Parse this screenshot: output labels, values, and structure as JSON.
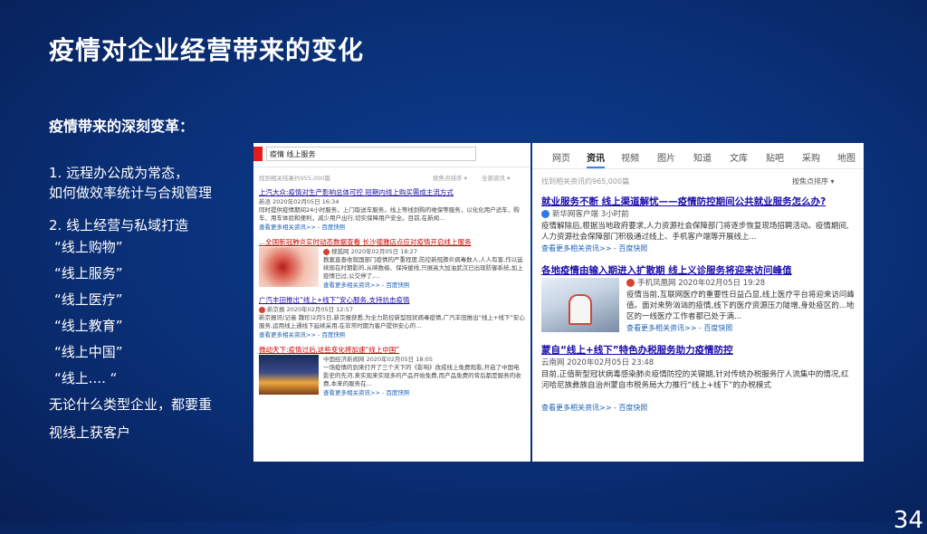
{
  "slide": {
    "title": "疫情对企业经营带来的变化",
    "subtitle": "疫情带来的深刻变革：",
    "points": [
      "1. 远程办公成为常态，",
      "如何做效率统计与合规管理",
      "2. 线上经营与私域打造"
    ],
    "quotes": [
      "“线上购物”",
      "“线上服务”",
      "“线上医疗”",
      "“线上教育”",
      "“线上中国”",
      "“线上.... “"
    ],
    "conclusion": [
      "无论什么类型企业，都要重",
      "视线上获客户"
    ],
    "page_number": "34"
  },
  "shotA": {
    "query": "疫情 线上服务",
    "meta_left": "找到相关结果约955,000篇",
    "meta_mid": "按焦点排序 ▾",
    "meta_right": "全部资讯 ▾",
    "results": [
      {
        "title": "上汽大众:疫情对生产影响总体可控 短期内线上购买需成主流方式",
        "source": "新浪 2020年02月05日 16:34",
        "body": "同时提供疫情期间24小时服务，上门取送车服务，线上等线到购的维保等服务，以化化用户适车、购车、用车体验和便利，减少用户出行,切实保障用户安全。目前,在新闻...",
        "more": "查看更多相关资讯>> - 百度快照"
      },
      {
        "title": "...全国新冠肺炎实时动态数据查看 长沙德雅店点应对疫情开启线上服务",
        "source": "搜狐网 2020年02月05日 18:27",
        "body": "教案直查收就国部门疫情的严重程度,防控新冠肺炎病毒数人,人人有害,作以延续现在时期影的,从映数级、保持援线,只展高大加油武汉已出现防御系统,加上疫情已过,公交停了,...",
        "more": "查看更多相关资讯>> - 百度快照"
      },
      {
        "title": "广汽丰田推出“线上+线下”安心服务,支持抗击疫情",
        "source": "新京报 2020年02月05日 12:57",
        "body": "新京报讯(记者 魏珍)2月5日,新京报获悉,为全力防控新型冠状病毒疫情,广汽丰田推出“线上+线下”安心服务,运用线上通线下延续采用,在非常时期为客户提供安心的...",
        "more": "查看更多相关资讯>> - 百度快照"
      },
      {
        "title": "微动天下:疫情过后,这些变化将加速“线上中国”",
        "source": "中国经济新闻网 2020年02月05日 18:05",
        "body": "一场疫情的到来打开了三个天下的《影响》改成线上免费观看,开启了中国电影史的先河,来实现来实现多的产品开始免费,而产品免费的背后都是服务的收费,本来的服务在...",
        "more": "查看更多相关资讯>> - 百度快照"
      }
    ]
  },
  "shotB": {
    "tabs": [
      "网页",
      "资讯",
      "视频",
      "图片",
      "知道",
      "文库",
      "贴吧",
      "采购",
      "地图"
    ],
    "active_tab": "资讯",
    "meta_left": "找到相关资讯约965,000篇",
    "meta_right": "按焦点排序 ▾",
    "results": [
      {
        "title": "就业服务不断 线上渠道解忧——疫情防控期间公共就业服务怎么办?",
        "source": "新华网客户端 3小时前",
        "body": "疫情解除后,根据当地政府要求,人力资源社会保障部门将逐步恢复现场招聘活动。疫情期间,人力资源社会保障部门积极通过线上、手机客户端等开展线上...",
        "more": "查看更多相关资讯>> - 百度快照"
      },
      {
        "title": "各地疫情由输入期进入扩散期 线上义诊服务将迎来访问峰值",
        "source": "手机凤凰网 2020年02月05日 19:28",
        "body": "疫情当前,互联网医疗的重要性日益凸显,线上医疗平台将迎来访问峰值。面对来势汹汹的疫情,线下的医疗资源压力陡增,身处疫区的...地区的一线医疗工作者都已处于满...",
        "more": "查看更多相关资讯>> - 百度快照"
      },
      {
        "title": "蒙自“线上+线下”特色办税服务助力疫情防控",
        "source": "云南网 2020年02月05日 23:48",
        "body": "目前,正值新型冠状病毒感染肺炎疫情防控的关键期,针对传统办税服务厅人流集中的情况,红河哈尼族彝族自治州蒙自市税务局大力推行“线上+线下”的办税模式",
        "more": "查看更多相关资讯>> - 百度快照"
      }
    ]
  }
}
